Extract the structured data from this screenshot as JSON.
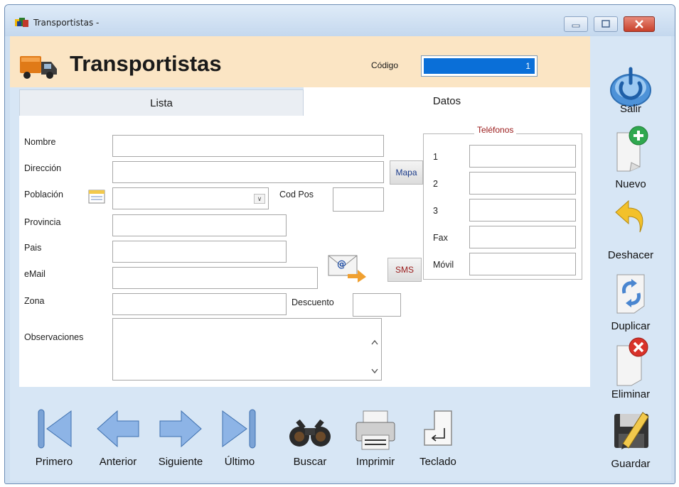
{
  "window": {
    "title": "Transportistas -"
  },
  "header": {
    "title": "Transportistas",
    "codigo_label": "Código",
    "codigo_value": "1"
  },
  "tabs": [
    {
      "label": "Lista"
    },
    {
      "label": "Datos"
    }
  ],
  "form": {
    "nombre_label": "Nombre",
    "direccion_label": "Dirección",
    "poblacion_label": "Población",
    "cod_pos_label": "Cod Pos",
    "provincia_label": "Provincia",
    "pais_label": "Pais",
    "email_label": "eMail",
    "zona_label": "Zona",
    "descuento_label": "Descuento",
    "observaciones_label": "Observaciones",
    "mapa_label": "Mapa",
    "sms_label": "SMS",
    "email_button_icon": "email-send-icon",
    "poblacion_icon": "calendar-list-icon"
  },
  "telefonos": {
    "legend": "Teléfonos",
    "labels": [
      "1",
      "2",
      "3",
      "Fax",
      "Móvil"
    ]
  },
  "right_buttons": {
    "salir": "Salir",
    "nuevo": "Nuevo",
    "deshacer": "Deshacer",
    "duplicar": "Duplicar",
    "eliminar": "Eliminar",
    "guardar": "Guardar"
  },
  "nav": {
    "primero": "Primero",
    "anterior": "Anterior",
    "siguiente": "Siguiente",
    "ultimo": "Último",
    "buscar": "Buscar",
    "imprimir": "Imprimir",
    "teclado": "Teclado"
  },
  "colors": {
    "header_bg": "#fbe5c4",
    "client_bg": "#d7e6f5",
    "selection": "#0a6fd8",
    "telefonos_legend": "#9a1a1a"
  }
}
